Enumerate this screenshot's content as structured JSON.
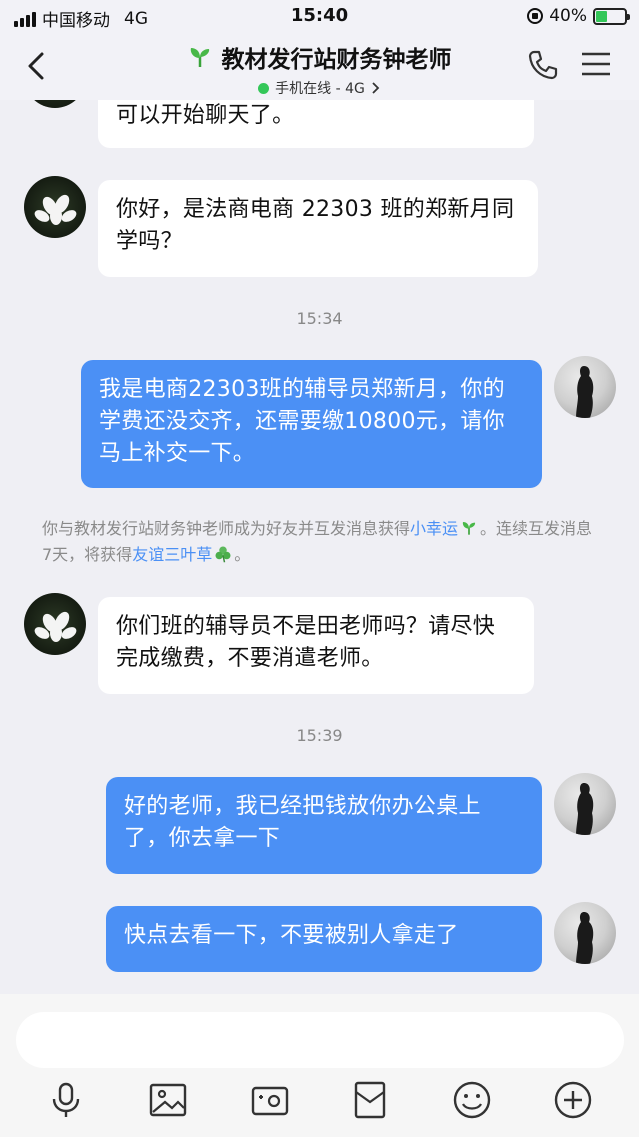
{
  "status_bar": {
    "carrier": "中国移动",
    "network": "4G",
    "time": "15:40",
    "battery": "40%",
    "battery_level": 0.4
  },
  "header": {
    "title": "教材发行站财务钟老师",
    "subtitle": "手机在线 - 4G",
    "online_color": "#34c759"
  },
  "messages": [
    {
      "side": "left",
      "text": "可以开始聊天了。"
    },
    {
      "side": "left",
      "text": "你好，是法商电商 22303 班的郑新月同学吗？"
    },
    {
      "time": "15:34"
    },
    {
      "side": "right",
      "text": "我是电商22303班的辅导员郑新月，你的学费还没交齐，还需要缴10800元，请你马上补交一下。"
    },
    {
      "system": {
        "part1": "你与教材发行站财务钟老师成为好友并互发消息获得",
        "link1": "小幸运",
        "part2": "。连续互发消息7天，将获得",
        "link2": "友谊三叶草",
        "part3": "。"
      }
    },
    {
      "side": "left",
      "text": "你们班的辅导员不是田老师吗？请尽快完成缴费，不要消遣老师。"
    },
    {
      "time": "15:39"
    },
    {
      "side": "right",
      "text": "好的老师，我已经把钱放你办公桌上了，你去拿一下"
    },
    {
      "side": "right",
      "text": "快点去看一下，不要被别人拿走了"
    }
  ],
  "toolbar": {
    "icons": [
      "microphone-icon",
      "image-icon",
      "camera-icon",
      "red-packet-icon",
      "emoji-icon",
      "plus-icon"
    ]
  },
  "colors": {
    "bubble_self": "#4b90f5",
    "bubble_other": "#ffffff",
    "background": "#efeff4"
  }
}
